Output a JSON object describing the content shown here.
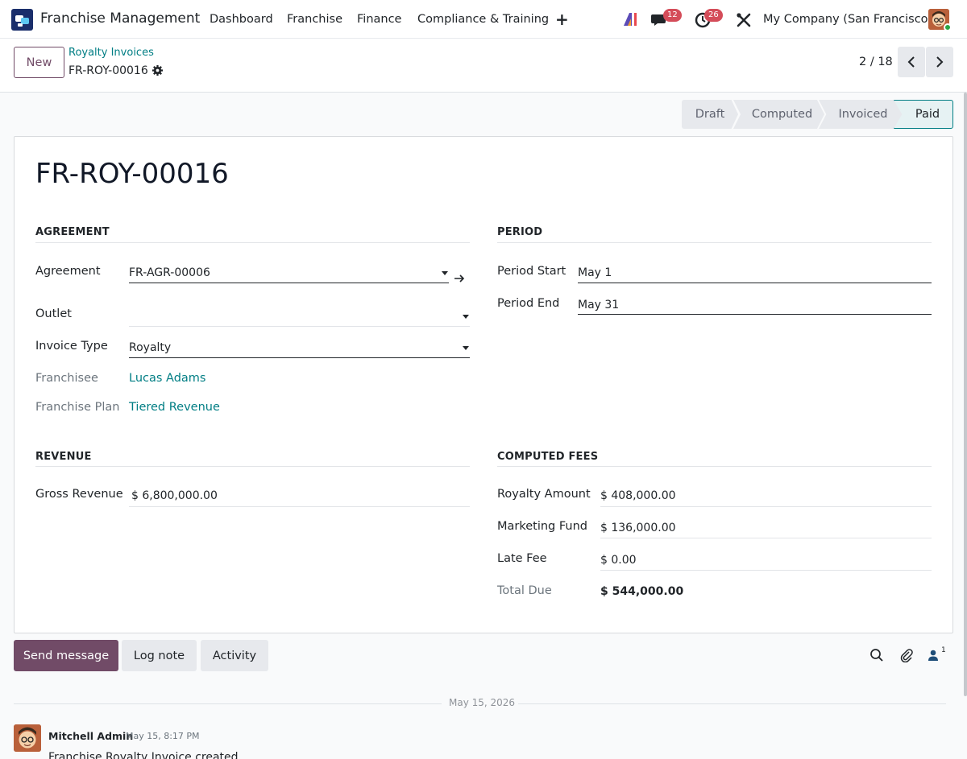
{
  "navbar": {
    "app_name": "Franchise Management",
    "menu": [
      "Dashboard",
      "Franchise",
      "Finance",
      "Compliance & Training"
    ],
    "messages_count": "12",
    "activities_count": "26",
    "company": "My Company (San Francisco)"
  },
  "control": {
    "new_label": "New",
    "breadcrumb_parent": "Royalty Invoices",
    "breadcrumb_current": "FR-ROY-00016",
    "pager": "2 / 18"
  },
  "statusbar": {
    "stages": [
      "Draft",
      "Computed",
      "Invoiced",
      "Paid"
    ],
    "active": "Paid"
  },
  "form": {
    "title": "FR-ROY-00016",
    "agreement_section": {
      "heading": "AGREEMENT",
      "agreement_label": "Agreement",
      "agreement_value": "FR-AGR-00006",
      "outlet_label": "Outlet",
      "outlet_value": "",
      "invoice_type_label": "Invoice Type",
      "invoice_type_value": "Royalty",
      "franchisee_label": "Franchisee",
      "franchisee_value": "Lucas Adams",
      "plan_label": "Franchise Plan",
      "plan_value": "Tiered Revenue"
    },
    "period_section": {
      "heading": "PERIOD",
      "start_label": "Period Start",
      "start_value": "May 1",
      "end_label": "Period End",
      "end_value": "May 31"
    },
    "revenue_section": {
      "heading": "REVENUE",
      "gross_label": "Gross Revenue",
      "gross_value": "$ 6,800,000.00"
    },
    "fees_section": {
      "heading": "COMPUTED FEES",
      "royalty_label": "Royalty Amount",
      "royalty_value": "$ 408,000.00",
      "marketing_label": "Marketing Fund",
      "marketing_value": "$ 136,000.00",
      "late_label": "Late Fee",
      "late_value": "$ 0.00",
      "total_label": "Total Due",
      "total_value": "$ 544,000.00"
    }
  },
  "chatter": {
    "send_message": "Send message",
    "log_note": "Log note",
    "activity": "Activity",
    "followers_count": "1",
    "date_separator": "May 15, 2026",
    "message": {
      "author": "Mitchell Admin",
      "time": "May 15, 8:17 PM",
      "body": "Franchise Royalty Invoice created"
    }
  },
  "colors": {
    "brand": "#714b67",
    "link": "#017e84",
    "badge": "#d44c59"
  }
}
